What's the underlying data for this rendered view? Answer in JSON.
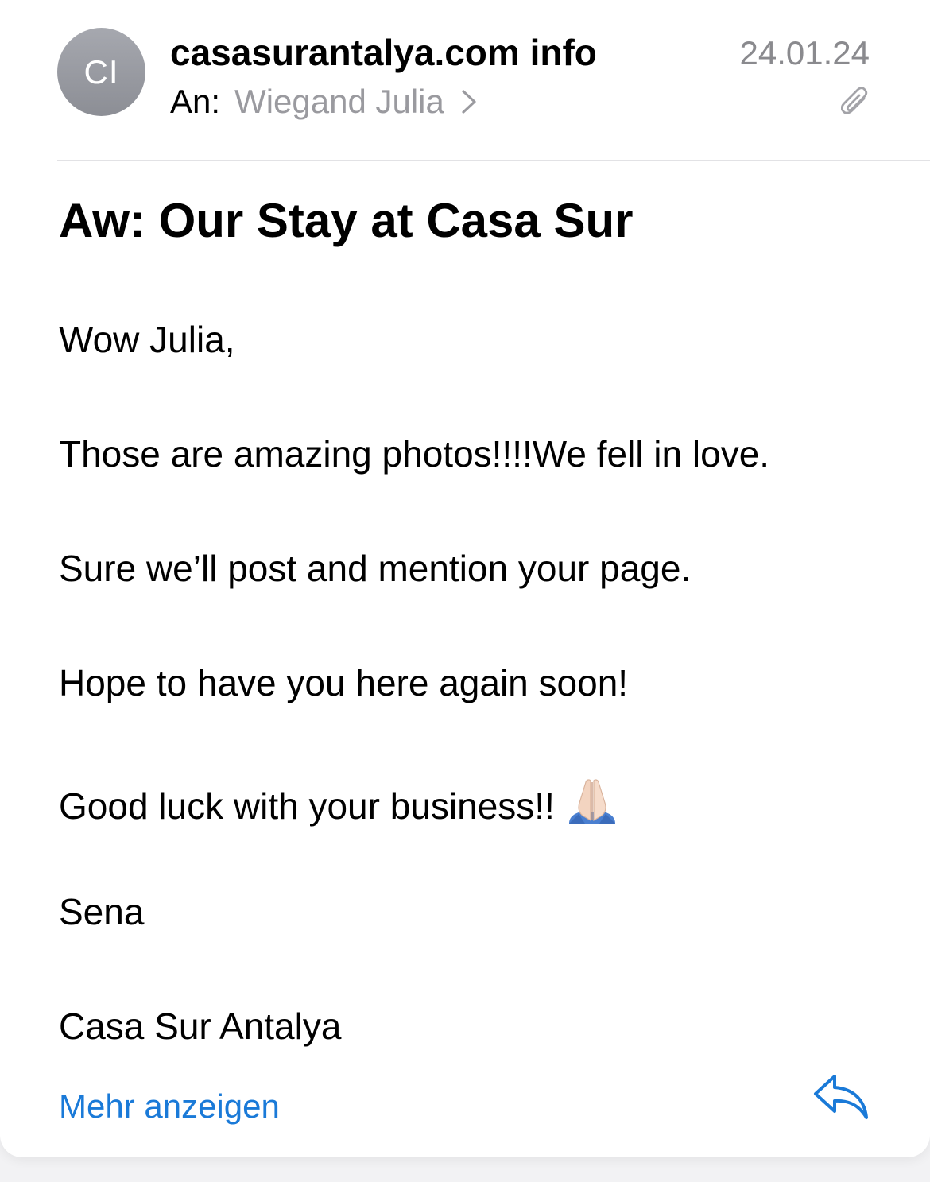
{
  "header": {
    "avatar_initials": "CI",
    "sender": "casasurantalya.com info",
    "date": "24.01.24",
    "to_label": "An:",
    "to_name": "Wiegand Julia"
  },
  "subject": "Aw: Our Stay at Casa Sur",
  "body": {
    "lines": [
      "Wow Julia,",
      "Those are amazing photos!!!!We fell in love.",
      "Sure we’ll post and mention your page.",
      "Hope to have you here again soon!",
      "Good luck with your business!!",
      "Sena",
      "Casa Sur Antalya"
    ]
  },
  "footer": {
    "more_label": "Mehr anzeigen"
  },
  "icons": {
    "chevron": "chevron-right-icon",
    "attachment": "paperclip-icon",
    "emoji": "folded-hands-emoji",
    "reply": "reply-arrow-icon"
  },
  "colors": {
    "accent": "#1a7ad8",
    "secondary_text": "#8a8a8e",
    "avatar": "#9a9ca3"
  }
}
